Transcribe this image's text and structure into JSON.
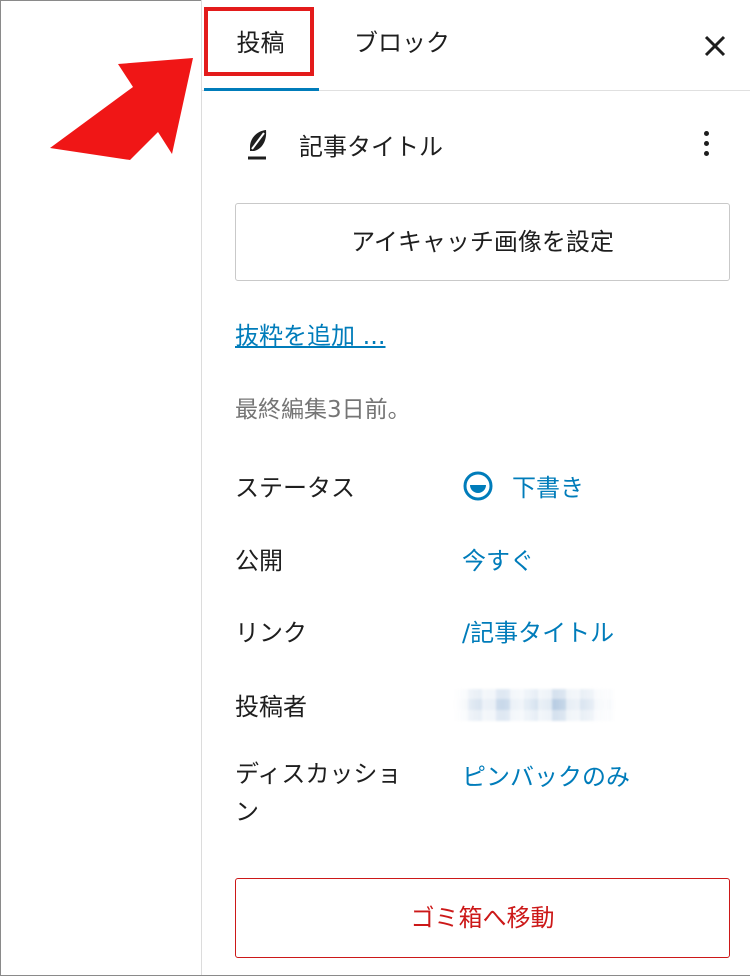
{
  "tabs": {
    "post": "投稿",
    "block": "ブロック"
  },
  "post": {
    "title": "記事タイトル"
  },
  "featured_image_button": "アイキャッチ画像を設定",
  "excerpt_link": "抜粋を追加 ...",
  "last_edited": "最終編集3日前。",
  "settings": {
    "status": {
      "label": "ステータス",
      "value": "下書き"
    },
    "publish": {
      "label": "公開",
      "value": "今すぐ"
    },
    "link": {
      "label": "リンク",
      "value": "/記事タイトル"
    },
    "author": {
      "label": "投稿者"
    },
    "discussion": {
      "label": "ディスカッション",
      "value": "ピンバックのみ"
    }
  },
  "trash_button": "ゴミ箱へ移動",
  "colors": {
    "accent": "#007cba",
    "danger": "#cc1818",
    "highlight": "#e31b1b"
  },
  "icons": {
    "close": "close-icon",
    "more": "more-vertical-icon",
    "post": "feather-icon",
    "status": "draft-status-icon",
    "annotation": "pointer-arrow-icon"
  }
}
